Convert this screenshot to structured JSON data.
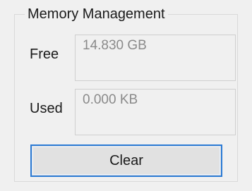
{
  "memory_management": {
    "title": "Memory Management",
    "free": {
      "label": "Free",
      "value": "14.830 GB"
    },
    "used": {
      "label": "Used",
      "value": "0.000 KB"
    },
    "clear_button": {
      "label": "Clear"
    }
  },
  "colors": {
    "background": "#f0f0f0",
    "button_focus_border": "#2a7ad5",
    "readonly_text": "#8a8a8a"
  }
}
